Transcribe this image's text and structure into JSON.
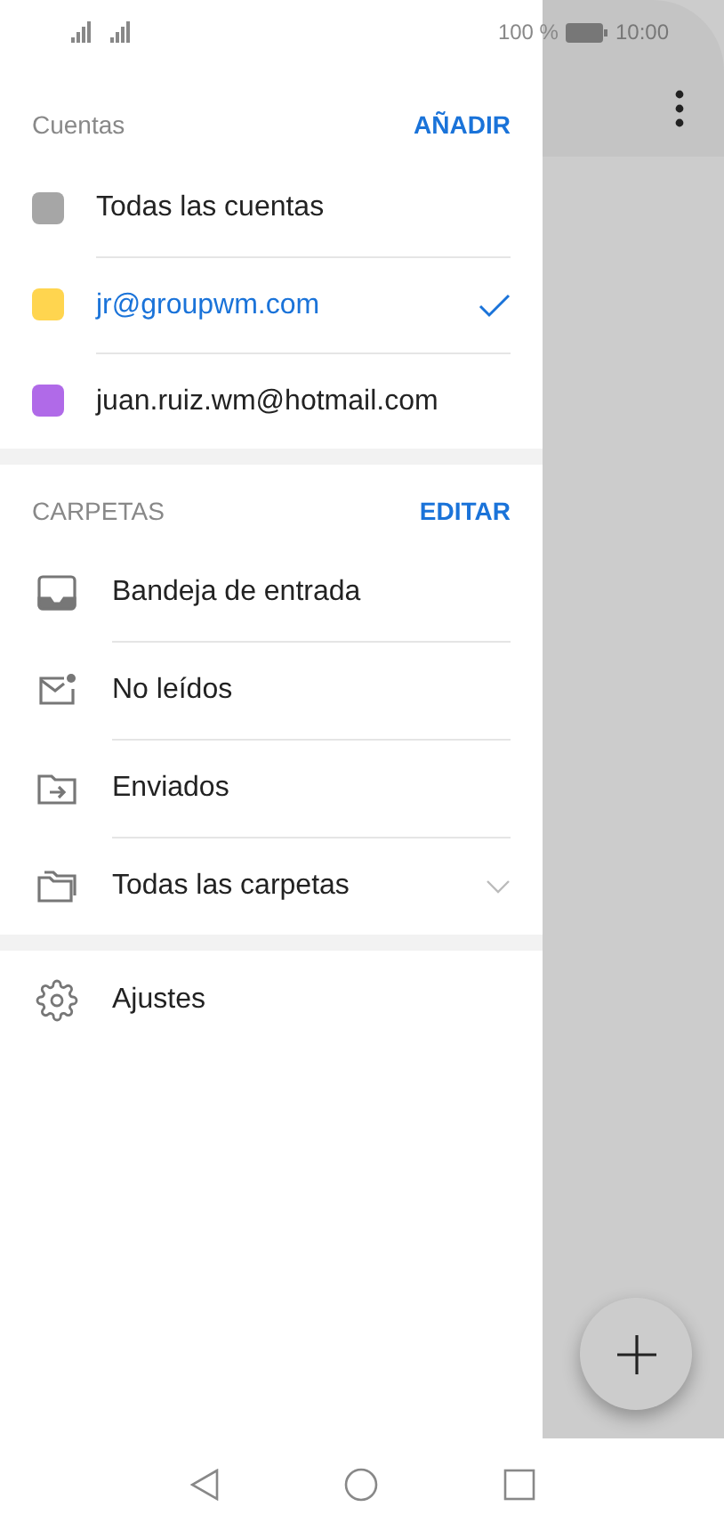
{
  "status_bar": {
    "battery": "100 %",
    "time": "10:00"
  },
  "accounts": {
    "title": "Cuentas",
    "action": "AÑADIR",
    "items": [
      {
        "label": "Todas las cuentas",
        "color": "#a6a6a6",
        "selected": false
      },
      {
        "label": "jr@groupwm.com",
        "color": "#ffd54f",
        "selected": true
      },
      {
        "label": "juan.ruiz.wm@hotmail.com",
        "color": "#b06ae8",
        "selected": false
      }
    ]
  },
  "folders": {
    "title": "CARPETAS",
    "action": "EDITAR",
    "items": [
      {
        "kind": "inbox",
        "label": "Bandeja de entrada"
      },
      {
        "kind": "unread",
        "label": "No leídos"
      },
      {
        "kind": "sent",
        "label": "Enviados"
      },
      {
        "kind": "all",
        "label": "Todas las carpetas",
        "expanded": false
      }
    ]
  },
  "settings": {
    "label": "Ajustes"
  }
}
